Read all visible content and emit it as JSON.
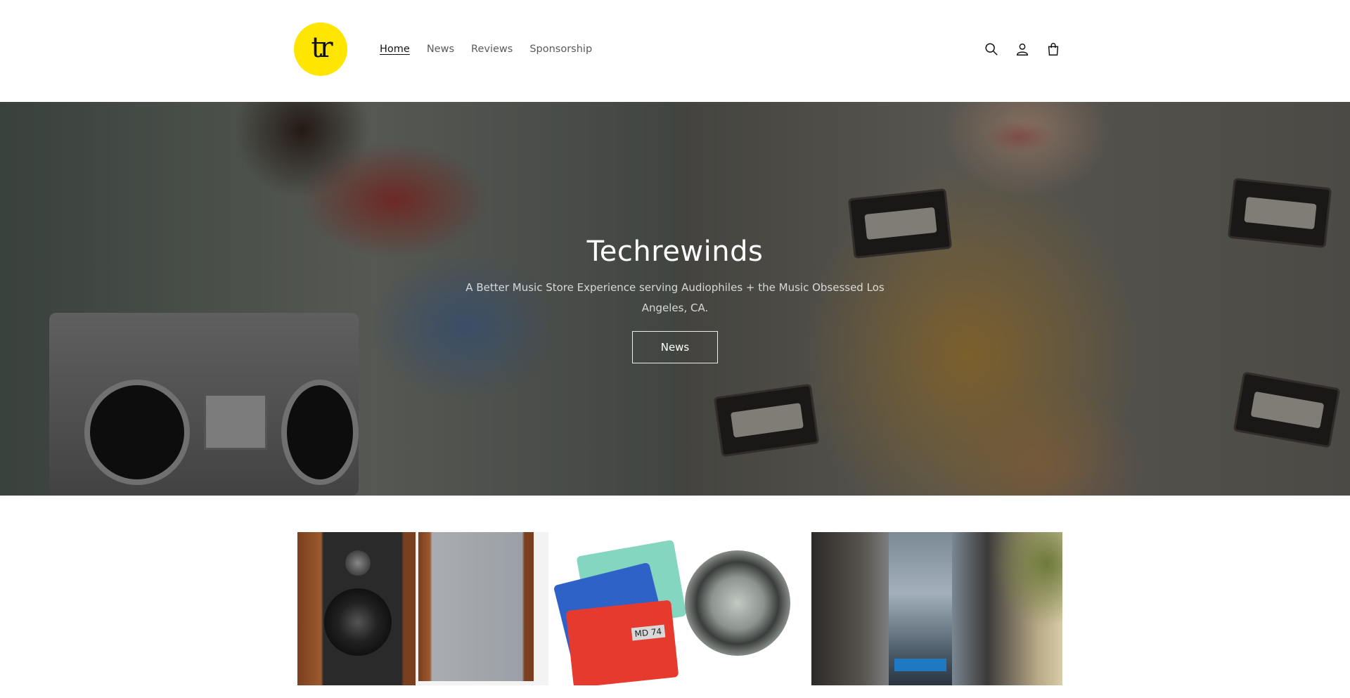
{
  "header": {
    "logo_text": "tr",
    "nav": [
      {
        "label": "Home",
        "active": true
      },
      {
        "label": "News",
        "active": false
      },
      {
        "label": "Reviews",
        "active": false
      },
      {
        "label": "Sponsorship",
        "active": false
      }
    ],
    "icons": [
      "search-icon",
      "account-icon",
      "cart-icon"
    ]
  },
  "hero": {
    "title": "Techrewinds",
    "subtitle": "A Better Music Store Experience serving Audiophiles + the Music Obsessed Los Angeles, CA.",
    "button_label": "News"
  },
  "collections": {
    "card2_label": "MD 74"
  },
  "colors": {
    "logo_bg": "#ffe600",
    "text": "#121212",
    "nav_muted": "#5a5a5a"
  }
}
